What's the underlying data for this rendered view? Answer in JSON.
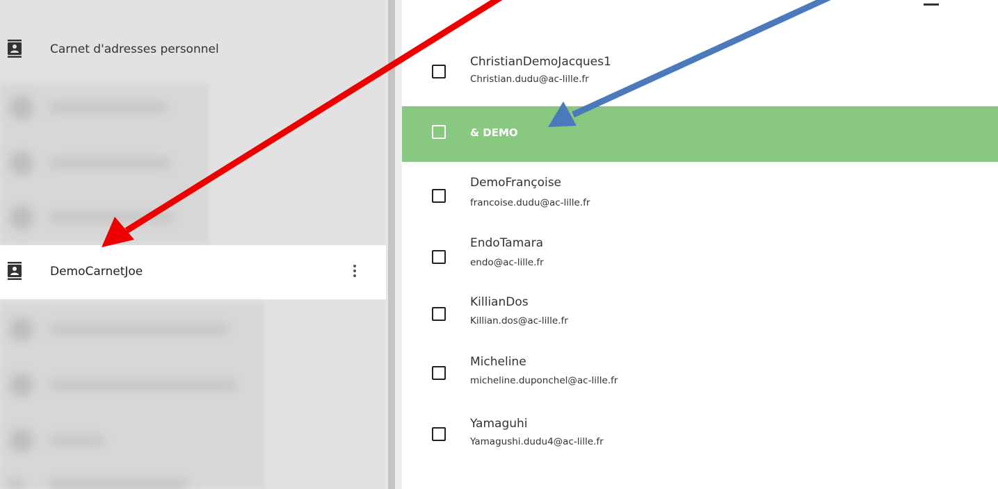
{
  "sidebar": {
    "personal_label": "Carnet d'adresses personnel",
    "selected_label": "DemoCarnetJoe",
    "personal_icon": "address-book-icon",
    "selected_icon": "address-book-icon",
    "menu_icon": "more-vertical-icon"
  },
  "contacts": [
    {
      "name": "ChristianDemoJacques1",
      "email": "Christian.dudu@ac-lille.fr"
    },
    {
      "name": "& DEMO",
      "email": ""
    },
    {
      "name": "DemoFrançoise",
      "email": "francoise.dudu@ac-lille.fr"
    },
    {
      "name": "EndoTamara",
      "email": "endo@ac-lille.fr"
    },
    {
      "name": "KillianDos",
      "email": "Killian.dos@ac-lille.fr"
    },
    {
      "name": "Micheline",
      "email": "micheline.duponchel@ac-lille.fr"
    },
    {
      "name": "Yamaguhi",
      "email": "Yamagushi.dudu4@ac-lille.fr"
    }
  ],
  "colors": {
    "highlight": "#89c880",
    "arrow_red": "#ee0000",
    "arrow_blue": "#4a7abb"
  }
}
